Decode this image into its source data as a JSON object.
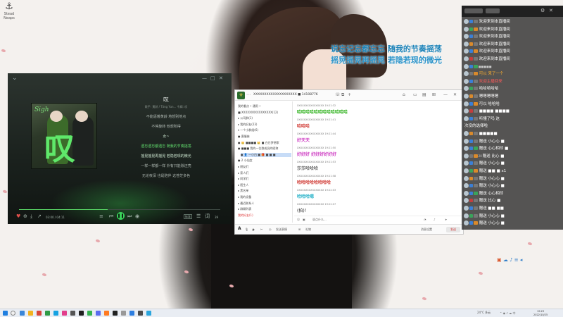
{
  "desktop": {
    "icon_label_1": "Stead",
    "icon_label_2": "Neaps"
  },
  "overlay_lyrics": {
    "line1": "说忘记忘都忘忘 随我的节奏摇荡",
    "line2": "摇晃摇晃再摇晃 若隐若现的微光"
  },
  "music_player": {
    "song_title": "叹",
    "song_meta": "歌手: 黄龄 / Tăng Yun...  专辑: 叹",
    "lyrics": [
      {
        "text": "不能逼着黄龄 地想别地点",
        "state": ""
      },
      {
        "text": "不停旋转 他想所得",
        "state": ""
      },
      {
        "text": "女~",
        "state": "active2"
      },
      {
        "text": "遗忘遗忘都遗忘 随我的节奏摇荡",
        "state": "active"
      },
      {
        "text": "摇晃摇晃再摇晃 若隐若现的微光",
        "state": "active2"
      },
      {
        "text": "一样一样都一样 外有只能除还亮",
        "state": ""
      },
      {
        "text": "无论夜深 也是陪伴 这苍茫多色",
        "state": ""
      }
    ],
    "progress": 0.44,
    "time_current": "03:00 / 04:11",
    "cover_script": "Sigh",
    "cover_big": "叹",
    "quality": "标准",
    "count": "39"
  },
  "chat": {
    "title": "XXXXXXXXXXXXXXXXXXXX ■ 14108776",
    "sidebar": [
      {
        "text": "我的看点 • 通用 •",
        "cls": ""
      },
      {
        "text": "■ XXXXXXXXXXXXXXXX(12)",
        "cls": ""
      },
      {
        "text": "▸ 公司群(1)",
        "cls": ""
      },
      {
        "text": "▸ 我的好友(23)",
        "cls": ""
      },
      {
        "text": "▾ 一个小群组(6)",
        "cls": ""
      },
      {
        "text": "● 客服妹",
        "cls": ""
      },
      {
        "text": "● 👑 ■■■■ 👑 ■ 白日梦想家",
        "cls": ""
      },
      {
        "text": "● ■■■ 我的一位群成员的昵称",
        "cls": ""
      },
      {
        "text": "● 👤 一小白 ■ 🎁 ■ ■ ■",
        "cls": "hl"
      },
      {
        "text": "● 2 小仙女",
        "cls": ""
      },
      {
        "text": "▸ 朋友们",
        "cls": ""
      },
      {
        "text": "▸ 家人们",
        "cls": ""
      },
      {
        "text": "▸ 同学们",
        "cls": ""
      },
      {
        "text": "▸ 陌生人",
        "cls": ""
      },
      {
        "text": "▸ 黑名单",
        "cls": ""
      },
      {
        "text": "▸ 我的设备",
        "cls": ""
      },
      {
        "text": "▸ 最近联系人",
        "cls": ""
      },
      {
        "text": "▸ 群聊列表",
        "cls": ""
      },
      {
        "text": "我的好友(1)",
        "cls": "red"
      }
    ],
    "messages": [
      {
        "head": "XXXXXXXXXXXXXXXX 19:21:32",
        "text": "哈哈哈哈哈哈哈哈哈哈哈哈",
        "cls": "green"
      },
      {
        "head": "XXXXXXXXXXXXXXXX 19:21:41",
        "text": "哈哈哈",
        "cls": "red"
      },
      {
        "head": "XXXXXXXXXXXXXXXX 19:21:44",
        "text": "好天天",
        "cls": "mag"
      },
      {
        "head": "XXXXXXXXXXXXXXXX 19:21:50",
        "text": "好好好 好好好好好好",
        "cls": "mag"
      },
      {
        "head": "XXXXXXXXXXXXXXXX 19:21:53",
        "text": "莎莎哈哈哈",
        "cls": "black"
      },
      {
        "head": "XXXXXXXXXXXXXXXX 19:21:58",
        "text": "哈哈哈哈哈哈哈哈",
        "cls": "red"
      },
      {
        "head": "XXXXXXXXXXXXXXXX 19:22:03",
        "text": "哈哈哈嗯",
        "cls": "cyan"
      },
      {
        "head": "XXXXXXXXXXXXXXXX 19:22:07",
        "text": "(拍)！",
        "cls": "black"
      }
    ],
    "input_placeholder": "说点什么...",
    "bottom_left": "发送表情",
    "bottom_mid": "礼物",
    "send_label": "发送",
    "bottom_extra": "消息设置"
  },
  "danmaku": {
    "rows": [
      {
        "badges": [
          "blue",
          "gray"
        ],
        "name": "",
        "text": "欢迎来到本直播间",
        "tcls": ""
      },
      {
        "badges": [
          "green",
          "orange"
        ],
        "name": "",
        "text": "欢迎来到本直播间",
        "tcls": ""
      },
      {
        "badges": [
          "blue",
          "gray"
        ],
        "name": "",
        "text": "欢迎来到本直播间",
        "tcls": ""
      },
      {
        "badges": [
          "orange",
          "gray"
        ],
        "name": "",
        "text": "欢迎来到本直播间",
        "tcls": ""
      },
      {
        "badges": [
          "blue",
          "orange"
        ],
        "name": "",
        "text": "欢迎来到本直播间",
        "tcls": ""
      },
      {
        "badges": [
          "red",
          "gray"
        ],
        "name": "",
        "text": "欢迎来到本直播间",
        "tcls": ""
      },
      {
        "badges": [
          "blue",
          "green"
        ],
        "name": "■■■■■",
        "text": "",
        "tcls": ""
      },
      {
        "badges": [
          "gray",
          "orange"
        ],
        "name": "",
        "text": "可以 来了一个",
        "tcls": "orange"
      },
      {
        "badges": [
          "blue",
          "gray"
        ],
        "name": "",
        "text": "欢迎主播回来",
        "tcls": "red"
      },
      {
        "badges": [
          "green",
          "gray"
        ],
        "name": "",
        "text": "哈哈哈哈哈",
        "tcls": ""
      },
      {
        "badges": [
          "orange",
          "gray"
        ],
        "name": "",
        "text": "嗯嗯嗯嗯嗯",
        "tcls": ""
      },
      {
        "badges": [
          "blue",
          "orange"
        ],
        "name": "",
        "text": "可以 哈哈哈",
        "tcls": ""
      },
      {
        "badges": [
          "red",
          "gray"
        ],
        "name": "",
        "text": "■■■■ ■■■■",
        "tcls": ""
      },
      {
        "badges": [
          "blue",
          "gray"
        ],
        "name": "",
        "text": "听懂了吗 这",
        "tcls": ""
      },
      {
        "badges": [],
        "name": "",
        "text": "次没的选择啦",
        "tcls": ""
      },
      {
        "badges": [
          "orange",
          "gray"
        ],
        "name": "",
        "text": "■■■■■",
        "tcls": ""
      },
      {
        "badges": [
          "blue",
          "gray"
        ],
        "name": "",
        "text": "赠送 小心心 ■",
        "tcls": ""
      },
      {
        "badges": [
          "blue",
          "green"
        ],
        "name": "",
        "text": "赠送 心心相印 ■",
        "tcls": ""
      },
      {
        "badges": [
          "gray",
          "orange"
        ],
        "name": "20",
        "text": "赠送 比心 ■",
        "tcls": ""
      },
      {
        "badges": [
          "blue",
          "gray"
        ],
        "name": "",
        "text": "赠送 小心心 ■",
        "tcls": ""
      },
      {
        "badges": [
          "green",
          "orange"
        ],
        "name": "",
        "text": "赠送 ■■ ■ x1",
        "tcls": ""
      },
      {
        "badges": [
          "orange",
          "gray"
        ],
        "name": "",
        "text": "赠送 小心心 ■",
        "tcls": ""
      },
      {
        "badges": [
          "blue",
          "gray"
        ],
        "name": "",
        "text": "赠送 小心心 ■",
        "tcls": ""
      },
      {
        "badges": [
          "blue",
          "green"
        ],
        "name": "",
        "text": "赠送 心心相印",
        "tcls": ""
      },
      {
        "badges": [
          "red",
          "gray"
        ],
        "name": "",
        "text": "赠送 比心 ■",
        "tcls": ""
      },
      {
        "badges": [
          "blue",
          "gray"
        ],
        "name": "",
        "text": "赠送 ■■ ■■",
        "tcls": ""
      },
      {
        "badges": [
          "green",
          "gray"
        ],
        "name": "",
        "text": "赠送 小心心 ■",
        "tcls": ""
      },
      {
        "badges": [
          "blue",
          "orange"
        ],
        "name": "",
        "text": "赠送 小心心 ■",
        "tcls": ""
      }
    ]
  },
  "taskbar": {
    "weather": "24°C 多云",
    "clock_time": "19:23",
    "clock_date": "2022/10/25"
  }
}
